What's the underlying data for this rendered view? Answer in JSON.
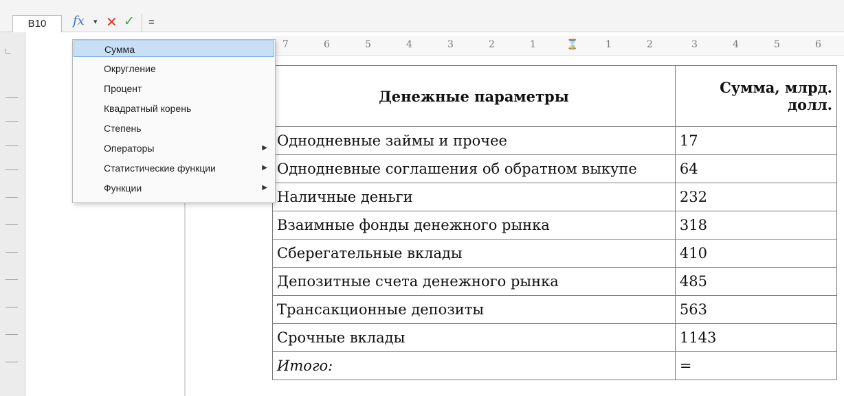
{
  "formula_bar": {
    "cell_reference": "B10",
    "fx_symbol": "fx",
    "cancel_symbol": "✕",
    "accept_symbol": "✓",
    "input_value": "="
  },
  "function_menu": {
    "items": [
      {
        "label": "Сумма",
        "has_submenu": false,
        "active": true
      },
      {
        "label": "Округление",
        "has_submenu": false,
        "active": false
      },
      {
        "label": "Процент",
        "has_submenu": false,
        "active": false
      },
      {
        "label": "Квадратный корень",
        "has_submenu": false,
        "active": false
      },
      {
        "label": "Степень",
        "has_submenu": false,
        "active": false
      },
      {
        "label": "Операторы",
        "has_submenu": true,
        "active": false
      },
      {
        "label": "Статистические функции",
        "has_submenu": true,
        "active": false
      },
      {
        "label": "Функции",
        "has_submenu": true,
        "active": false
      }
    ]
  },
  "ruler": {
    "labels": [
      "7",
      "6",
      "5",
      "4",
      "3",
      "2",
      "1",
      "1",
      "2",
      "3",
      "4",
      "5",
      "6"
    ]
  },
  "table": {
    "headers": [
      "Денежные параметры",
      "Сумма, млрд. долл."
    ],
    "rows": [
      [
        "Однодневные займы и прочее",
        "17"
      ],
      [
        "Однодневные соглашения об обратном выкупе",
        "64"
      ],
      [
        "Наличные деньги",
        "232"
      ],
      [
        "Взаимные фонды денежного рынка",
        "318"
      ],
      [
        "Сберегательные вклады",
        "410"
      ],
      [
        "Депозитные счета денежного рынка",
        "485"
      ],
      [
        "Трансакционные депозиты",
        "563"
      ],
      [
        "Срочные вклады",
        "1143"
      ],
      [
        "Итого:",
        "="
      ]
    ]
  },
  "colors": {
    "menu_highlight": "#c9dff5",
    "cancel": "#e0312c",
    "accept": "#3aa23a",
    "fx": "#3b6cc7"
  }
}
